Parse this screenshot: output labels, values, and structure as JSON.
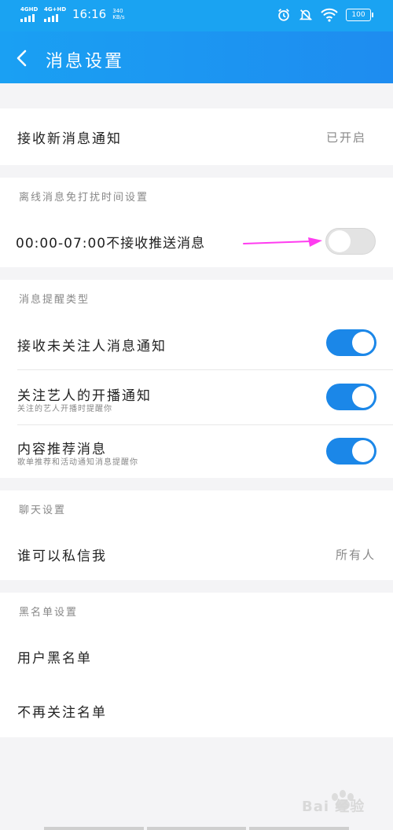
{
  "status_bar": {
    "network1": "4GHD",
    "network2": "4G+HD",
    "time": "16:16",
    "speed_value": "340",
    "speed_unit": "KB/s",
    "battery": "100",
    "icons": [
      "alarm-icon",
      "mute-icon",
      "wifi-icon",
      "battery-icon"
    ]
  },
  "header": {
    "title": "消息设置"
  },
  "new_message": {
    "label": "接收新消息通知",
    "value": "已开启"
  },
  "offline": {
    "section_title": "离线消息免打扰时间设置",
    "label": "00:00-07:00不接收推送消息",
    "enabled": false
  },
  "reminder": {
    "section_title": "消息提醒类型",
    "items": [
      {
        "label": "接收未关注人消息通知",
        "sub": "",
        "enabled": true
      },
      {
        "label": "关注艺人的开播通知",
        "sub": "关注的艺人开播时提醒你",
        "enabled": true
      },
      {
        "label": "内容推荐消息",
        "sub": "歌单推荐和活动通知消息提醒你",
        "enabled": true
      }
    ]
  },
  "chat": {
    "section_title": "聊天设置",
    "label": "谁可以私信我",
    "value": "所有人"
  },
  "blacklist": {
    "section_title": "黑名单设置",
    "items": [
      "用户黑名单",
      "不再关注名单"
    ]
  },
  "watermark": {
    "text": "Bai 经验"
  },
  "colors": {
    "accent": "#1b87e8",
    "header": "#1aa0f3",
    "annotation_arrow": "#ff3cf0"
  }
}
